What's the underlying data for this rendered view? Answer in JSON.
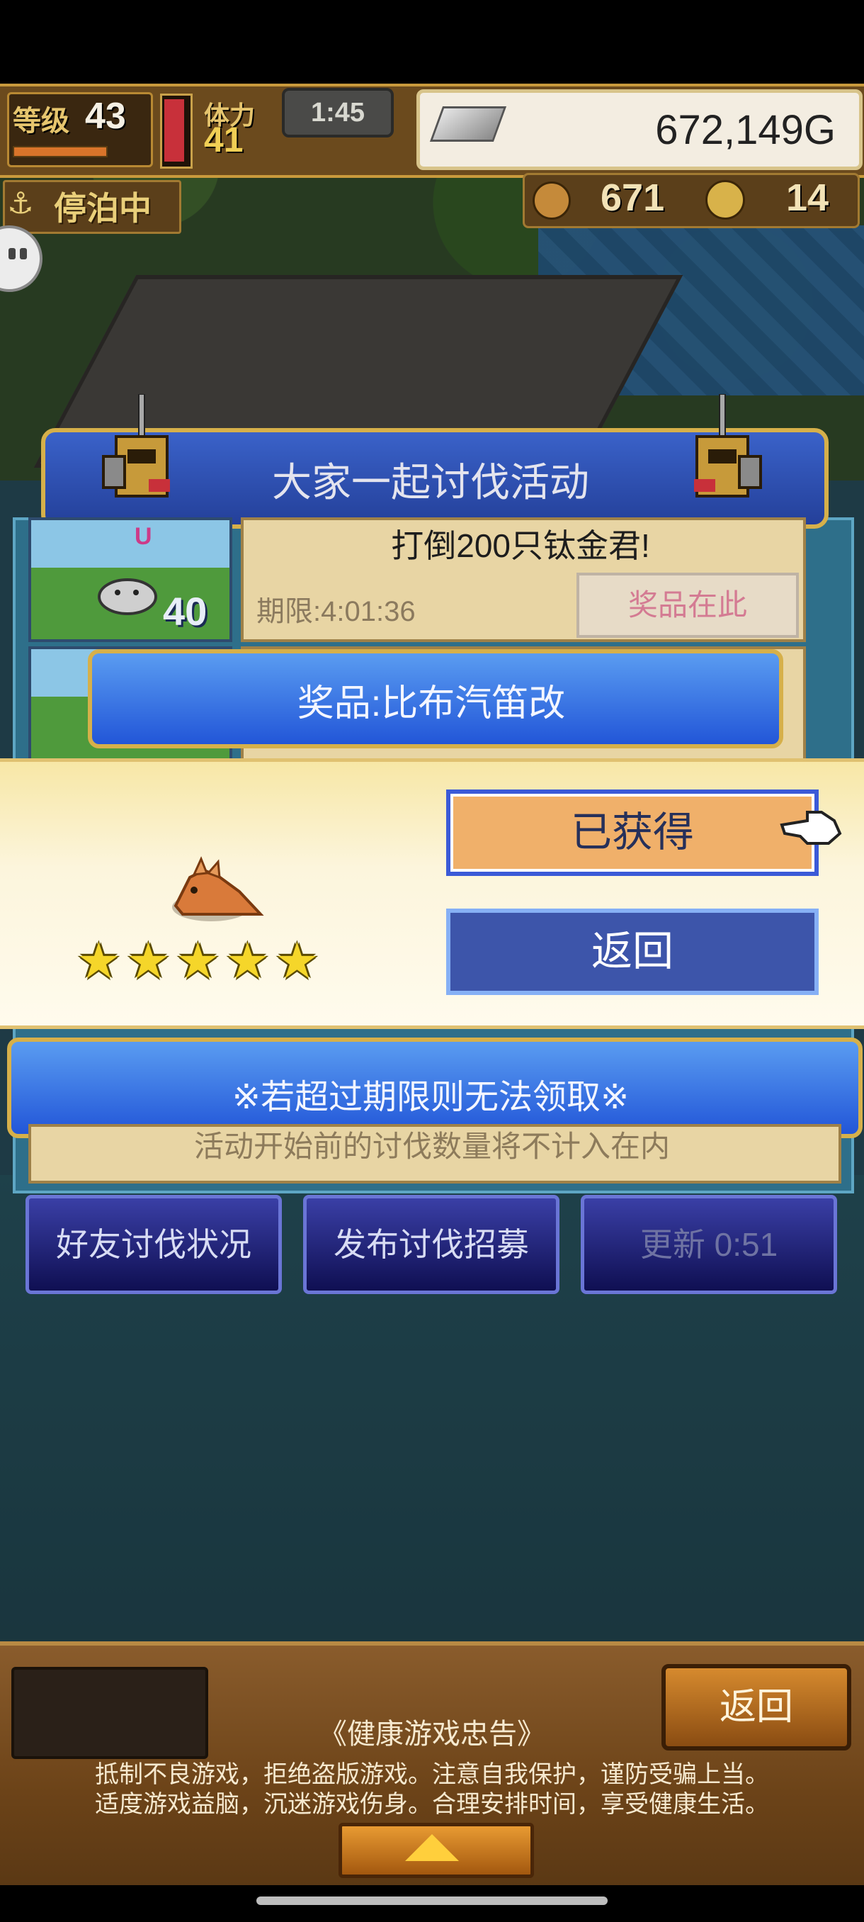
{
  "hud": {
    "level_label": "等级",
    "level_value": "43",
    "stamina_label": "体力",
    "stamina_value": "41",
    "timer": "1:45",
    "money": "672,149G",
    "docked_label": "停泊中",
    "resource1": "671",
    "resource2": "14"
  },
  "event": {
    "title": "大家一起讨伐活动",
    "quest_name": "打倒200只钛金君!",
    "deadline": "期限:4:01:36",
    "prize_button": "奖品在此",
    "thumb_count": "40",
    "thumb_tag": "U"
  },
  "prize": {
    "banner": "奖品:比布汽笛改",
    "stars": 5,
    "obtained_button": "已获得",
    "return_button": "返回"
  },
  "notice": {
    "banner": "※若超过期限则无法领取※",
    "footer_text": "活动开始前的讨伐数量将不计入在内"
  },
  "nav": {
    "friends": "好友讨伐状况",
    "publish": "发布讨伐招募",
    "refresh": "更新 0:51"
  },
  "bottom": {
    "return_button": "返回",
    "health_title": "《健康游戏忠告》",
    "health_line1": "抵制不良游戏，拒绝盗版游戏。注意自我保护，谨防受骗上当。",
    "health_line2": "适度游戏益脑，沉迷游戏伤身。合理安排时间，享受健康生活。"
  },
  "colors": {
    "accent_blue": "#2256d8",
    "obtained_orange": "#f0b06a",
    "gold_border": "#d6b04a"
  }
}
